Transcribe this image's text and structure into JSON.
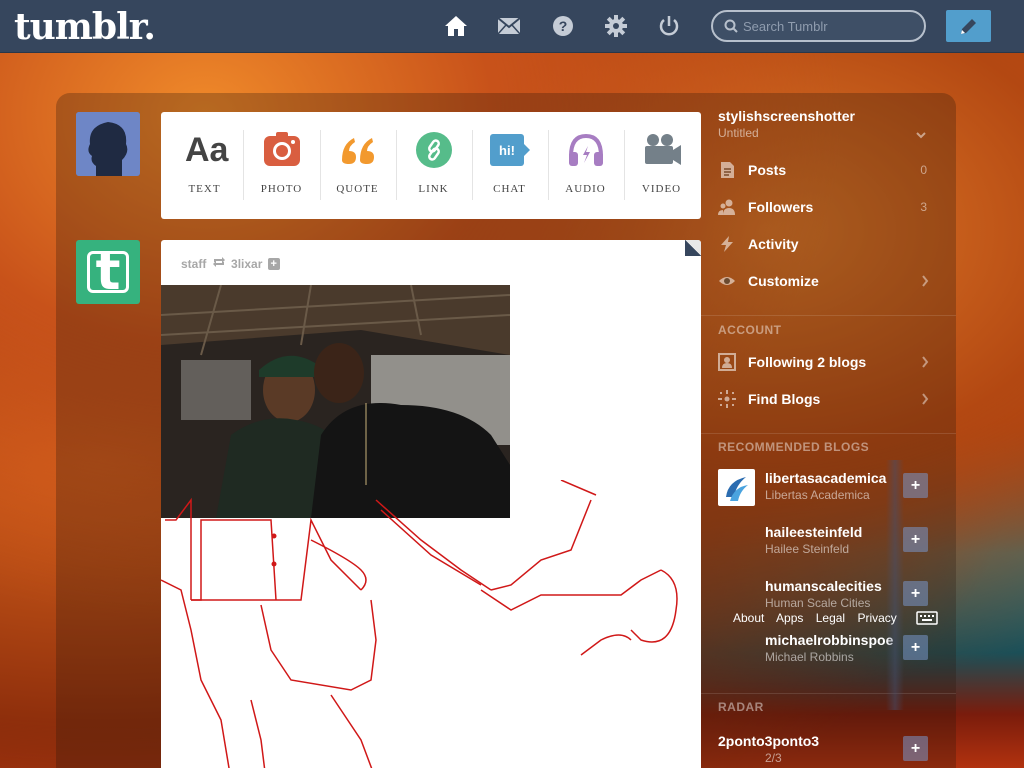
{
  "app": {
    "logo": "tumblr."
  },
  "nav": {
    "icons": [
      "home-icon",
      "mail-icon",
      "help-icon",
      "settings-icon",
      "power-icon"
    ],
    "search_placeholder": "Search Tumblr",
    "compose_icon": "pencil-icon"
  },
  "post_types": [
    {
      "label": "TEXT",
      "icon": "text-icon",
      "glyph": "Aa",
      "color": "#444444"
    },
    {
      "label": "PHOTO",
      "icon": "camera-icon",
      "color": "#d95e40"
    },
    {
      "label": "QUOTE",
      "icon": "quote-icon",
      "glyph": "““",
      "color": "#f2992e"
    },
    {
      "label": "LINK",
      "icon": "link-icon",
      "color": "#56bc8a"
    },
    {
      "label": "CHAT",
      "icon": "chat-icon",
      "glyph": "hi!",
      "color": "#529ecc"
    },
    {
      "label": "AUDIO",
      "icon": "headphones-icon",
      "color": "#a77dc2"
    },
    {
      "label": "VIDEO",
      "icon": "video-camera-icon",
      "color": "#748089"
    }
  ],
  "post": {
    "author": "staff",
    "reblogged_from": "3lixar"
  },
  "sidebar": {
    "blog_name": "stylishscreenshotter",
    "blog_title": "Untitled",
    "items": [
      {
        "label": "Posts",
        "count": "0",
        "icon": "document-icon"
      },
      {
        "label": "Followers",
        "count": "3",
        "icon": "followers-icon"
      },
      {
        "label": "Activity",
        "count": "",
        "icon": "lightning-icon"
      },
      {
        "label": "Customize",
        "count": "",
        "icon": "eye-icon"
      }
    ],
    "account_heading": "ACCOUNT",
    "account_items": [
      {
        "label": "Following 2 blogs",
        "icon": "following-icon"
      },
      {
        "label": "Find Blogs",
        "icon": "compass-icon"
      }
    ],
    "recommended_heading": "RECOMMENDED BLOGS",
    "recommended": [
      {
        "name": "libertasacademica",
        "title": "Libertas Academica"
      },
      {
        "name": "haileesteinfeld",
        "title": "Hailee Steinfeld"
      },
      {
        "name": "humanscalecities",
        "title": "Human Scale Cities"
      },
      {
        "name": "michaelrobbinspoems",
        "title": "Michael Robbins"
      }
    ],
    "radar_heading": "RADAR",
    "radar_item": {
      "name": "2ponto3ponto3",
      "title": "2/3"
    }
  },
  "footer": {
    "links": [
      "About",
      "Apps",
      "Legal",
      "Privacy"
    ]
  },
  "colors": {
    "topbar": "#36465d",
    "accent": "#529ecc",
    "avatar_green": "#36b27e"
  }
}
